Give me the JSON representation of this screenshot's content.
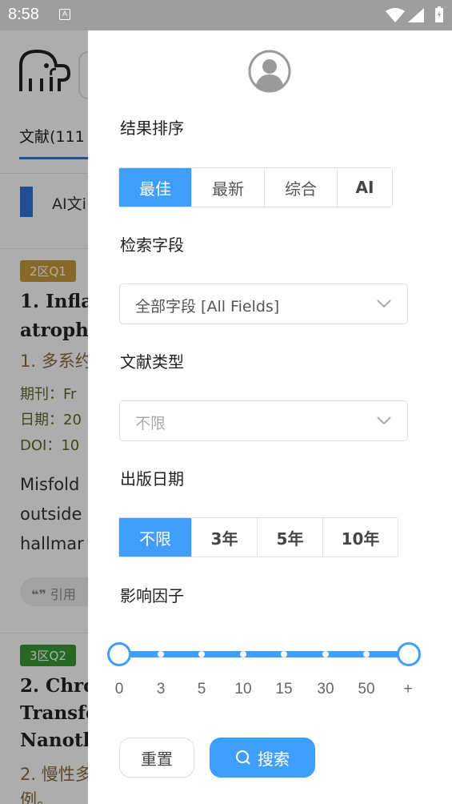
{
  "status_bar": {
    "time": "8:58",
    "notification_icon": "A"
  },
  "background": {
    "tab_label": "文献(111",
    "ai_label": "AI文i",
    "cards": [
      {
        "badge": "2区Q1",
        "badge_color": "#c99a3c",
        "title_line1": "1. Infla",
        "title_line2": "atrophy",
        "subtitle": "1. 多系约",
        "meta": [
          "期刊：Fr",
          "日期：20",
          "DOI：10"
        ],
        "abstract": [
          "Misfold",
          "outside",
          "hallmar"
        ],
        "cite": "引用"
      },
      {
        "badge": "3区Q2",
        "badge_color": "#3a9a3a",
        "title_line1": "2. Chro",
        "title_line2": "Transfe",
        "title_line3": "Nanoth",
        "subtitle": "2. 慢性多",
        "subtitle2": "例。"
      }
    ]
  },
  "drawer": {
    "sort": {
      "title": "结果排序",
      "options": [
        "最佳",
        "最新",
        "综合",
        "AI"
      ],
      "selected": "最佳"
    },
    "field": {
      "title": "检索字段",
      "value": "全部字段 [All Fields]"
    },
    "doc_type": {
      "title": "文献类型",
      "placeholder": "不限"
    },
    "pub_date": {
      "title": "出版日期",
      "options": [
        "不限",
        "3年",
        "5年",
        "10年"
      ],
      "selected": "不限"
    },
    "impact": {
      "title": "影响因子",
      "ticks": [
        "0",
        "3",
        "5",
        "10",
        "15",
        "30",
        "50",
        "+"
      ],
      "range_min": "0",
      "range_max": "+"
    },
    "buttons": {
      "reset": "重置",
      "search": "搜索"
    }
  },
  "colors": {
    "accent": "#409eff",
    "overlay": "rgba(0,0,0,0.32)"
  }
}
